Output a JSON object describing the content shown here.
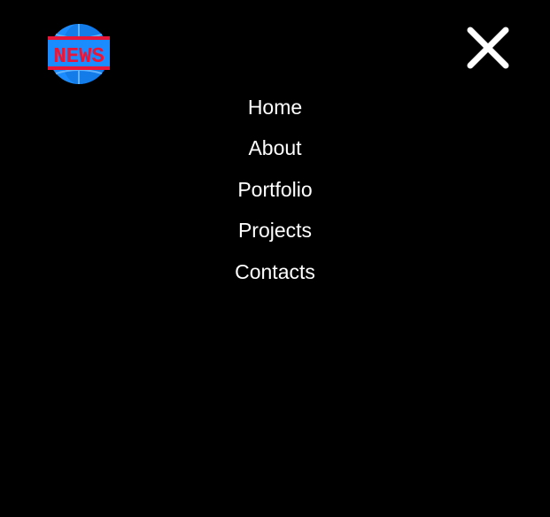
{
  "logo": {
    "icon": "news-globe-icon",
    "text": "NEWS",
    "colors": {
      "globe": "#1a8cff",
      "globe_dark": "#0f6fd6",
      "banner": "#e8173a",
      "text": "#e8173a"
    }
  },
  "close": {
    "icon": "close-icon",
    "color": "#ffffff"
  },
  "nav": {
    "items": [
      {
        "label": "Home"
      },
      {
        "label": "About"
      },
      {
        "label": "Portfolio"
      },
      {
        "label": "Projects"
      },
      {
        "label": "Contacts"
      }
    ]
  },
  "theme": {
    "background": "#000000",
    "text": "#ffffff"
  }
}
